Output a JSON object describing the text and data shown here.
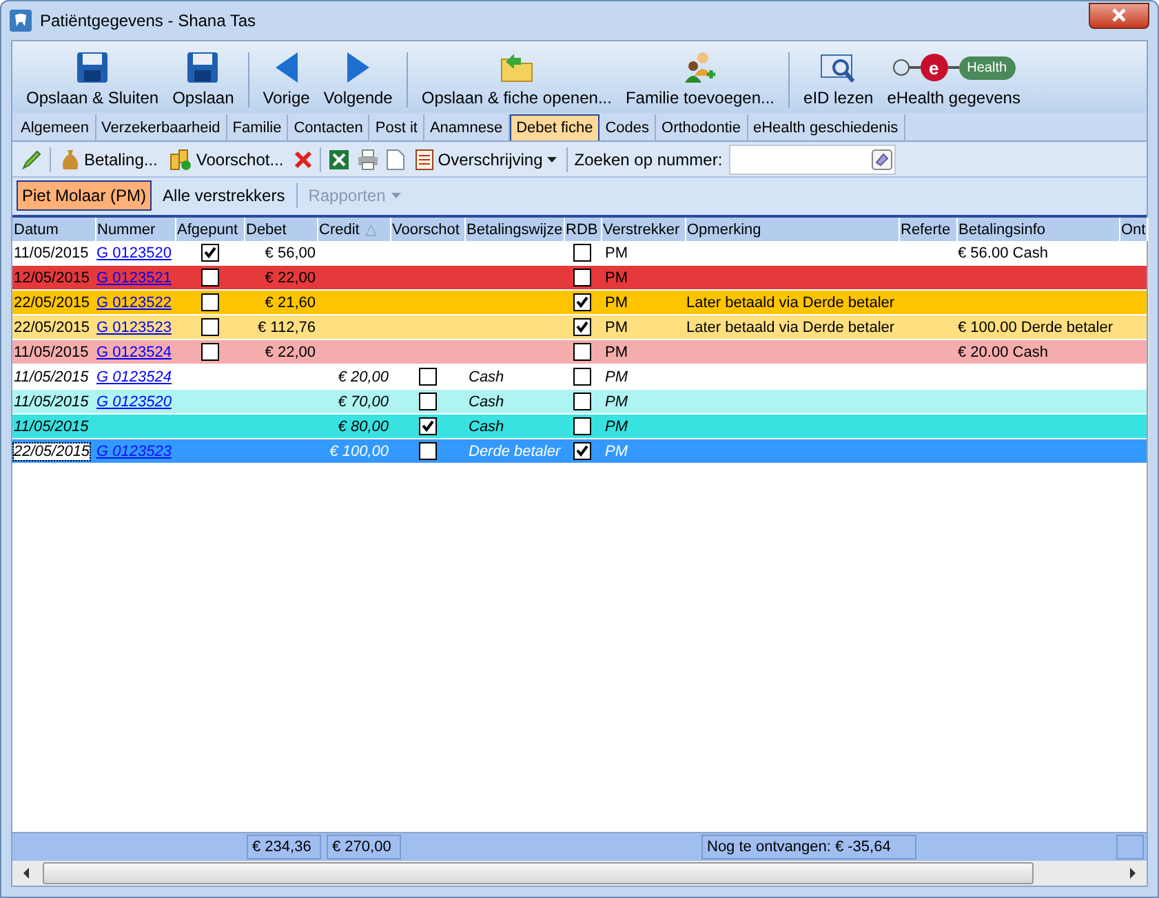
{
  "window": {
    "title": "Patiëntgegevens - Shana Tas"
  },
  "toolbar": [
    {
      "label": "Opslaan & Sluiten",
      "kind": "save"
    },
    {
      "label": "Opslaan",
      "kind": "save"
    },
    {
      "label": "Vorige",
      "kind": "prev"
    },
    {
      "label": "Volgende",
      "kind": "next"
    },
    {
      "label": "Opslaan & fiche openen...",
      "kind": "folder"
    },
    {
      "label": "Familie toevoegen...",
      "kind": "people"
    },
    {
      "label": "eID lezen",
      "kind": "eid"
    },
    {
      "label": "eHealth gegevens",
      "kind": "ehealth",
      "logo_letter": "e",
      "logo_text": "Health"
    }
  ],
  "tabs": [
    {
      "label": "Algemeen",
      "selected": false
    },
    {
      "label": "Verzekerbaarheid",
      "selected": false
    },
    {
      "label": "Familie",
      "selected": false
    },
    {
      "label": "Contacten",
      "selected": false
    },
    {
      "label": "Post it",
      "selected": false
    },
    {
      "label": "Anamnese",
      "selected": false
    },
    {
      "label": "Debet fiche",
      "selected": true
    },
    {
      "label": "Codes",
      "selected": false
    },
    {
      "label": "Orthodontie",
      "selected": false
    },
    {
      "label": "eHealth geschiedenis",
      "selected": false
    }
  ],
  "actions": {
    "payment": "Betaling...",
    "advance": "Voorschot...",
    "transfer": "Overschrijving",
    "search_label": "Zoeken op nummer:"
  },
  "providers": [
    {
      "label": "Piet Molaar (PM)",
      "selected": true
    },
    {
      "label": "Alle verstrekkers",
      "selected": false
    }
  ],
  "reports": {
    "label": "Rapporten",
    "disabled": true
  },
  "table": {
    "columns": [
      "Datum",
      "Nummer",
      "Afgepunt",
      "Debet",
      "Credit",
      "Voorschot",
      "Betalingswijze",
      "RDB",
      "Verstrekker",
      "Opmerking",
      "Referte",
      "Betalingsinfo",
      "Ont"
    ],
    "sort_indicator": "△",
    "rows": [
      {
        "kind": "debit",
        "date": "11/05/2015",
        "number": "G 0123520",
        "afgepunt": true,
        "debet": "€ 56,00",
        "rdb": false,
        "provider": "PM",
        "info": "€ 56.00 Cash",
        "color": "#ffffff",
        "selected": false
      },
      {
        "kind": "debit",
        "date": "12/05/2015",
        "number": "G 0123521",
        "afgepunt": false,
        "debet": "€ 22,00",
        "rdb": false,
        "provider": "PM",
        "color": "#e5393b",
        "selected": false
      },
      {
        "kind": "debit",
        "date": "22/05/2015",
        "number": "G 0123522",
        "afgepunt": false,
        "debet": "€ 21,60",
        "rdb": true,
        "provider": "PM",
        "remark": "Later betaald via Derde betaler",
        "color": "#ffc400",
        "selected": false
      },
      {
        "kind": "debit",
        "date": "22/05/2015",
        "number": "G 0123523",
        "afgepunt": false,
        "debet": "€ 112,76",
        "rdb": true,
        "provider": "PM",
        "remark": "Later betaald via Derde betaler",
        "info": "€ 100.00 Derde betaler",
        "color": "#ffdf80",
        "selected": false
      },
      {
        "kind": "debit",
        "date": "11/05/2015",
        "number": "G 0123524",
        "afgepunt": false,
        "debet": "€ 22,00",
        "rdb": false,
        "provider": "PM",
        "info": "€ 20.00 Cash",
        "color": "#f4acac",
        "selected": false
      },
      {
        "kind": "credit",
        "date": "11/05/2015",
        "number": "G 0123524",
        "credit": "€ 20,00",
        "voorschot": false,
        "method": "Cash",
        "rdb": false,
        "provider": "PM",
        "color": "#ffffff",
        "selected": false
      },
      {
        "kind": "credit",
        "date": "11/05/2015",
        "number": "G 0123520",
        "credit": "€ 70,00",
        "voorschot": false,
        "method": "Cash",
        "rdb": false,
        "provider": "PM",
        "color": "#aef4f2",
        "selected": false
      },
      {
        "kind": "credit",
        "date": "11/05/2015",
        "credit": "€ 80,00",
        "voorschot": true,
        "method": "Cash",
        "rdb": false,
        "provider": "PM",
        "color": "#38e2e0",
        "selected": false
      },
      {
        "kind": "credit",
        "date": "22/05/2015",
        "number": "G 0123523",
        "credit": "€ 100,00",
        "voorschot": false,
        "method": "Derde betaler",
        "rdb": true,
        "provider": "PM",
        "color": "#3399ff",
        "selected": true
      }
    ]
  },
  "totals": {
    "debet": "€ 234,36",
    "credit": "€ 270,00",
    "remaining": "Nog te ontvangen: € -35,64"
  }
}
